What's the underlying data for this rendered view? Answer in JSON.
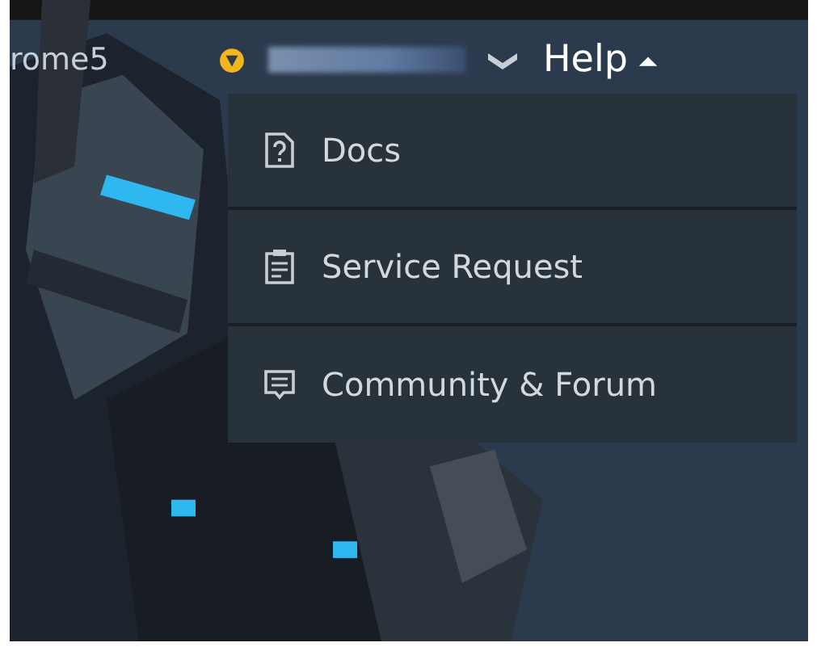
{
  "nav": {
    "item": "rome5",
    "help": {
      "label": "Help",
      "expanded": true
    }
  },
  "help_menu": {
    "items": [
      {
        "label": "Docs",
        "kind": "docs"
      },
      {
        "label": "Service Request",
        "kind": "request"
      },
      {
        "label": "Community & Forum",
        "kind": "forum"
      }
    ]
  }
}
